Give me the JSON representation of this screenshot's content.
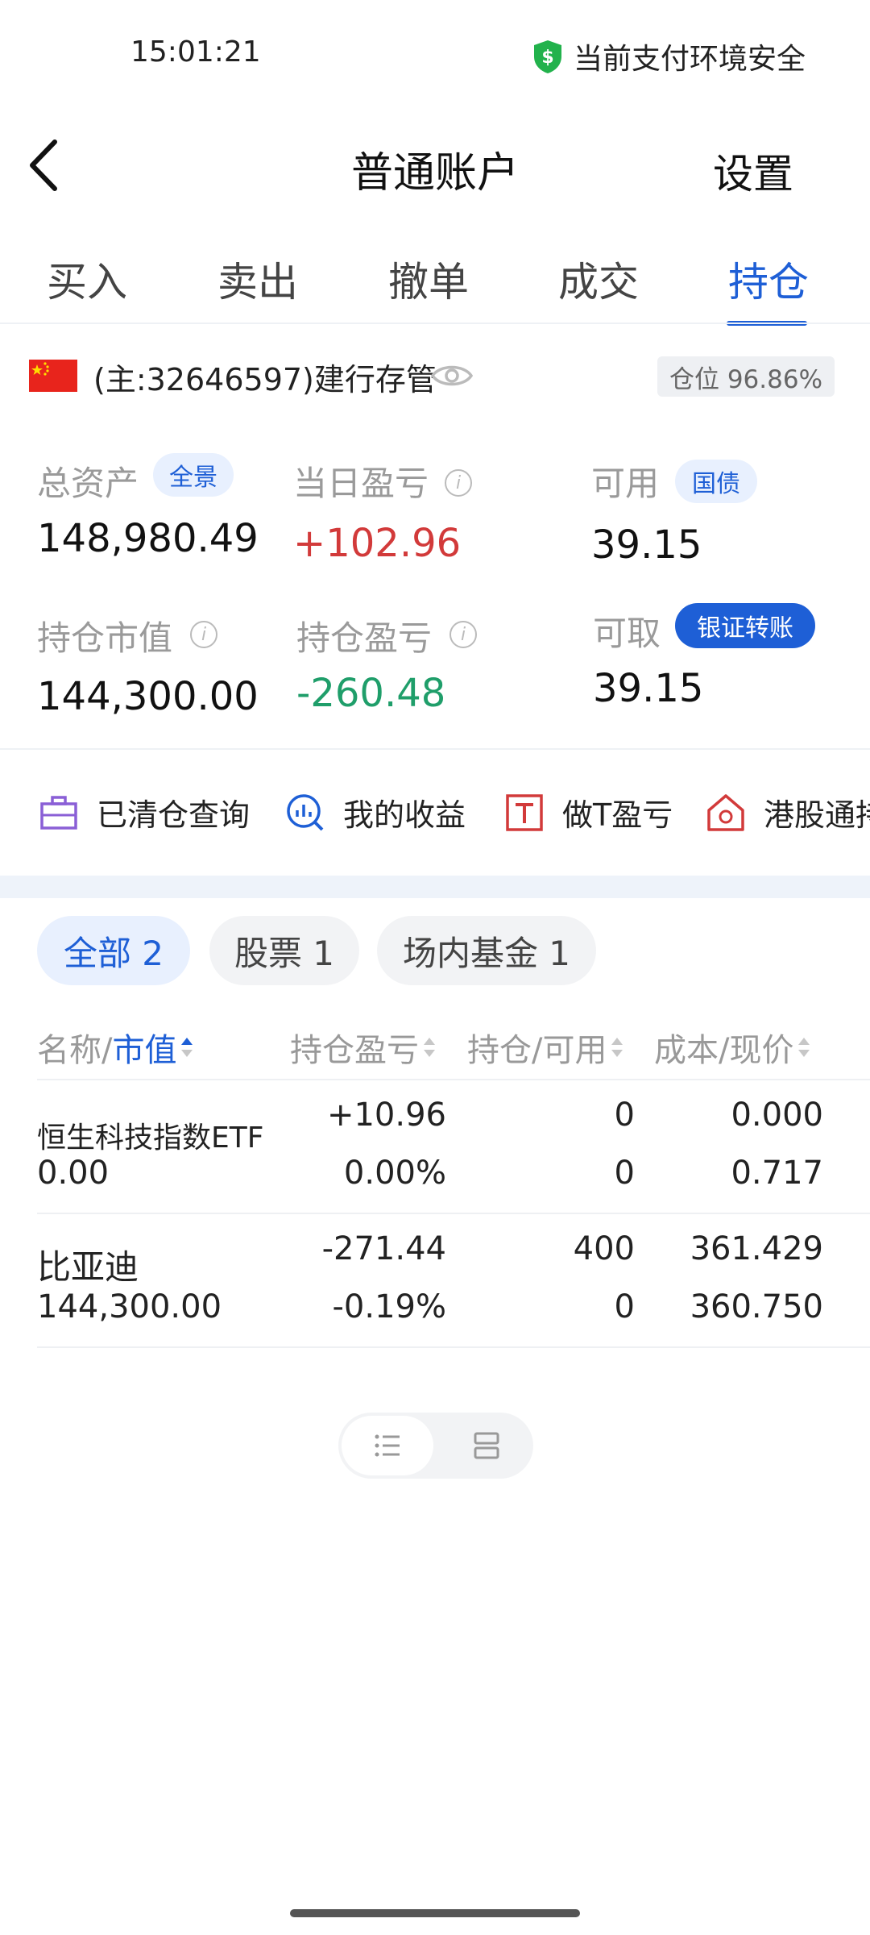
{
  "status": {
    "time": "15:01:21",
    "secure_text": "当前支付环境安全"
  },
  "header": {
    "title": "普通账户",
    "settings_label": "设置"
  },
  "tabs": [
    {
      "label": "买入",
      "active": false
    },
    {
      "label": "卖出",
      "active": false
    },
    {
      "label": "撤单",
      "active": false
    },
    {
      "label": "成交",
      "active": false
    },
    {
      "label": "持仓",
      "active": true
    }
  ],
  "account": {
    "id_text": "(主:32646597)建行存管",
    "position_ratio": "仓位 96.86%"
  },
  "metrics": {
    "total_assets": {
      "label": "总资产",
      "tag": "全景",
      "value": "148,980.49"
    },
    "daily_pnl": {
      "label": "当日盈亏",
      "value": "+102.96"
    },
    "available": {
      "label": "可用",
      "tag": "国债",
      "value": "39.15"
    },
    "position_value": {
      "label": "持仓市值",
      "value": "144,300.00"
    },
    "position_pnl": {
      "label": "持仓盈亏",
      "value": "-260.48"
    },
    "withdrawable": {
      "label": "可取",
      "tag": "银证转账",
      "value": "39.15"
    }
  },
  "shortcuts": [
    {
      "label": "已清仓查询",
      "icon": "briefcase-icon"
    },
    {
      "label": "我的收益",
      "icon": "chart-search-icon"
    },
    {
      "label": "做T盈亏",
      "icon": "t-box-icon"
    },
    {
      "label": "港股通持",
      "icon": "hk-house-icon"
    }
  ],
  "filters": [
    {
      "label": "全部 2",
      "active": true
    },
    {
      "label": "股票 1",
      "active": false
    },
    {
      "label": "场内基金 1",
      "active": false
    }
  ],
  "table": {
    "headers": {
      "name": "名称/",
      "name_sort": "市值",
      "pnl": "持仓盈亏",
      "qty": "持仓/可用",
      "cost": "成本/现价"
    },
    "rows": [
      {
        "name": "恒生科技指数ETF",
        "market_value": "0.00",
        "pnl": "+10.96",
        "pnl_pct": "0.00%",
        "qty": "0",
        "avail": "0",
        "cost": "0.000",
        "price": "0.717"
      },
      {
        "name": "比亚迪",
        "market_value": "144,300.00",
        "pnl": "-271.44",
        "pnl_pct": "-0.19%",
        "qty": "400",
        "avail": "0",
        "cost": "361.429",
        "price": "360.750"
      }
    ]
  },
  "colors": {
    "accent": "#1e5fd6",
    "up": "#d23a3a",
    "down": "#1f9e6a"
  }
}
